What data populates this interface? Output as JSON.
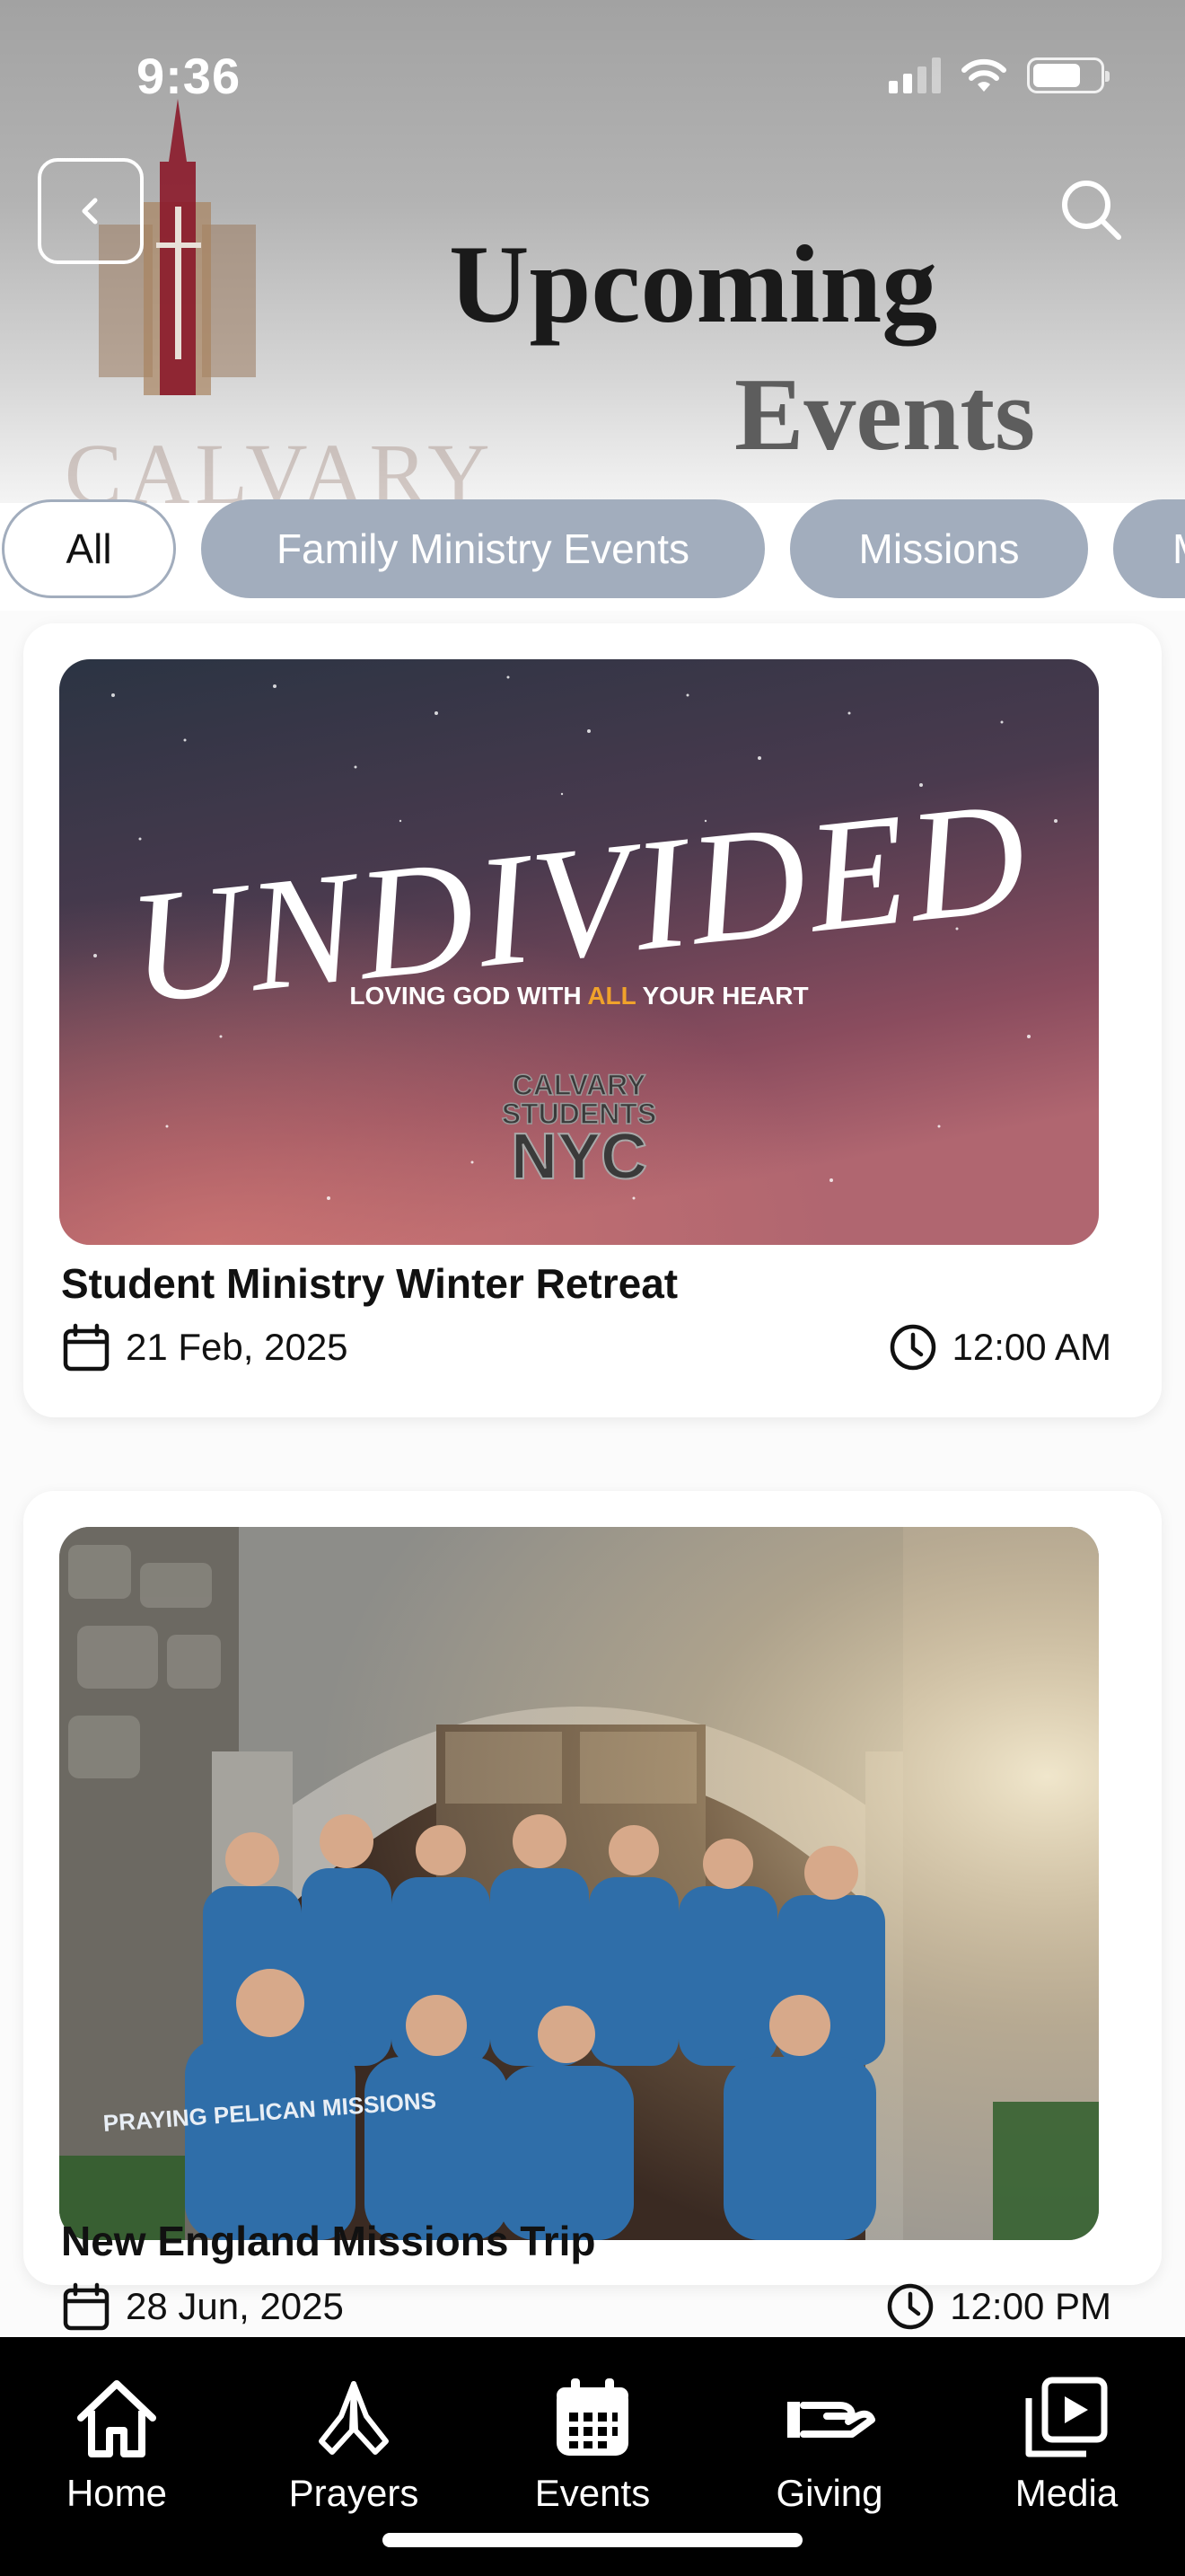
{
  "status_bar": {
    "time": "9:36"
  },
  "header": {
    "title_line1": "Upcoming",
    "title_line2": "Events",
    "logo_text": "CALVARY",
    "back_icon": "chevron-left-icon",
    "search_icon": "search-icon"
  },
  "filters": {
    "items": [
      {
        "label": "All",
        "active": true
      },
      {
        "label": "Family Ministry Events",
        "active": false
      },
      {
        "label": "Missions",
        "active": false
      },
      {
        "label": "Ministry",
        "active": false
      }
    ]
  },
  "events": [
    {
      "title": "Student Ministry Winter Retreat",
      "date": "21 Feb, 2025",
      "time": "12:00 AM",
      "image": {
        "headline": "UNDIVIDED",
        "tagline_pre": "LOVING GOD WITH ",
        "tagline_highlight": "ALL",
        "tagline_post": " YOUR HEART",
        "badge_line1": "CALVARY",
        "badge_line2": "STUDENTS",
        "badge_line3": "NYC"
      }
    },
    {
      "title": "New England Missions Trip",
      "date": "28 Jun, 2025",
      "time": "12:00 PM",
      "image": {
        "shirt_text": "PRAYING PELICAN MISSIONS"
      }
    }
  ],
  "tabbar": {
    "items": [
      {
        "label": "Home",
        "icon": "home-icon"
      },
      {
        "label": "Prayers",
        "icon": "praying-hands-icon"
      },
      {
        "label": "Events",
        "icon": "calendar-icon"
      },
      {
        "label": "Giving",
        "icon": "giving-hand-icon"
      },
      {
        "label": "Media",
        "icon": "media-play-icon"
      }
    ]
  },
  "colors": {
    "chip_bg": "#a2adbd",
    "tabbar_bg": "#000000",
    "highlight": "#f0a22b"
  }
}
